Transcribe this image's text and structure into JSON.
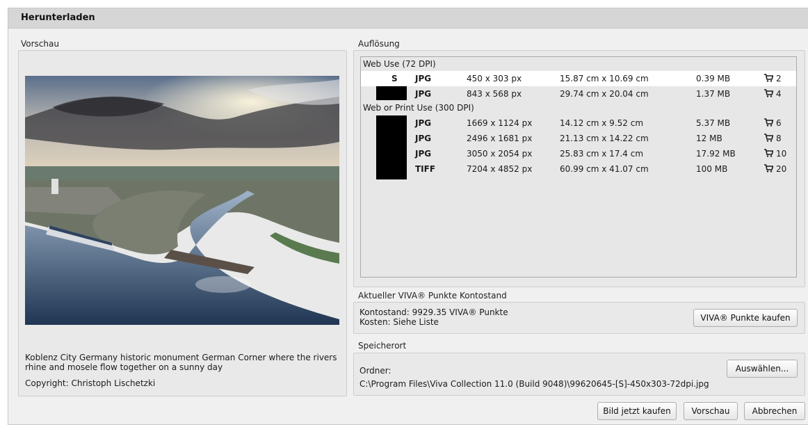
{
  "window": {
    "title": "Herunterladen"
  },
  "preview": {
    "label": "Vorschau",
    "caption": "Koblenz City Germany historic monument German Corner where the rivers rhine and mosele flow together on a sunny day",
    "copyright": "Copyright: Christoph Lischetzki"
  },
  "resolution": {
    "label": "Auflösung",
    "groups": [
      {
        "name": "Web Use (72 DPI)",
        "rows": [
          {
            "size": "S",
            "format": "JPG",
            "pixels": "450 x 303 px",
            "cm": "15.87 cm x 10.69 cm",
            "mb": "0.39 MB",
            "points": "2",
            "selected": true
          },
          {
            "size": "",
            "format": "JPG",
            "pixels": "843 x 568 px",
            "cm": "29.74 cm x 20.04 cm",
            "mb": "1.37 MB",
            "points": "4"
          }
        ]
      },
      {
        "name": "Web or Print Use (300 DPI)",
        "rows": [
          {
            "size": "",
            "format": "JPG",
            "pixels": "1669 x 1124 px",
            "cm": "14.12 cm x 9.52 cm",
            "mb": "5.37 MB",
            "points": "6"
          },
          {
            "size": "",
            "format": "JPG",
            "pixels": "2496 x 1681 px",
            "cm": "21.13 cm x 14.22 cm",
            "mb": "12 MB",
            "points": "8"
          },
          {
            "size": "",
            "format": "JPG",
            "pixels": "3050 x 2054 px",
            "cm": "25.83 cm x 17.4 cm",
            "mb": "17.92 MB",
            "points": "10"
          },
          {
            "size": "",
            "format": "TIFF",
            "pixels": "7204 x 4852 px",
            "cm": "60.99 cm x 41.07 cm",
            "mb": "100 MB",
            "points": "20"
          }
        ]
      }
    ]
  },
  "account": {
    "label": "Aktueller VIVA® Punkte Kontostand",
    "balance": "Kontostand: 9929.35 VIVA® Punkte",
    "cost": "Kosten: Siehe Liste",
    "buy_points_button": "VIVA® Punkte kaufen"
  },
  "storage": {
    "label": "Speicherort",
    "folder_label": "Ordner:",
    "path": "C:\\Program Files\\Viva Collection 11.0 (Build 9048)\\99620645-[S]-450x303-72dpi.jpg",
    "choose_button": "Auswählen..."
  },
  "footer": {
    "buy_now": "Bild jetzt kaufen",
    "preview": "Vorschau",
    "cancel": "Abbrechen"
  },
  "icons": {
    "cart": "shopping-cart-icon"
  },
  "colors": {
    "selected_row": "#ffffff",
    "redaction": "#000000",
    "titlebar": "#d6d6d6"
  }
}
